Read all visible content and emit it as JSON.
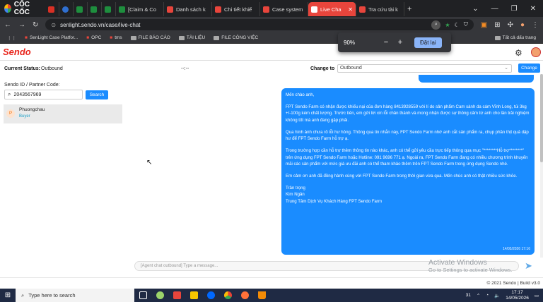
{
  "browser": {
    "brand": "CỐC CỐC",
    "tabs": [
      {
        "label": "",
        "color": "#d93025"
      },
      {
        "label": "",
        "color": "#2f6fd0"
      },
      {
        "label": "",
        "color": "#1e8e3e"
      },
      {
        "label": "",
        "color": "#1e8e3e"
      },
      {
        "label": "",
        "color": "#1e8e3e"
      },
      {
        "label": "[Claim & Co",
        "color": "#1e8e3e"
      },
      {
        "label": "Danh sách k",
        "color": "#e8453c"
      },
      {
        "label": "Chi tiết khiế",
        "color": "#e8453c"
      },
      {
        "label": "Case system",
        "color": "#e8453c"
      },
      {
        "label": "Live Cha",
        "color": "#e8453c",
        "active": true
      },
      {
        "label": "Tra cứu tài k",
        "color": "#e8453c"
      }
    ],
    "url": "senlight.sendo.vn/case/live-chat",
    "bookmarks": [
      "SenLight Case Platfor...",
      "OPC",
      "tms",
      "FILE BÁO CÁO",
      "TÀI LIỆU",
      "FILE CÔNG VIỆC"
    ],
    "all_bookmarks": "Tất cả dấu trang",
    "zoom": {
      "value": "90%",
      "minus": "−",
      "plus": "+",
      "reset": "Đặt lại"
    }
  },
  "app": {
    "logo": "Sendo",
    "status_label": "Current Status:",
    "status_value": "Outbound",
    "timer": "--:--",
    "change_to_label": "Change to",
    "change_to_value": "Outbound",
    "change_button": "Change"
  },
  "left": {
    "search_label": "Sendo ID / Partner Code:",
    "search_value": "2043567969",
    "search_button": "Search",
    "contacts": [
      {
        "initial": "P",
        "name": "Phuongchau",
        "role": "Buyer"
      }
    ]
  },
  "chat": {
    "paragraphs": [
      "Mến chào anh,",
      "FPT Sendo Farm có nhận được khiếu nại của đơn hàng 8413928559 với lí do sản phẩm Cam sành da cám Vĩnh Long, túi 3kg +/-100g kém chất lượng. Trước tiên, em gửi lời xin lỗi chân thành và mong nhận được sự thông cảm từ anh cho lần trải nghiệm không tốt mà anh đang gặp phải.",
      "Qua hình ảnh chưa rõ lỗi hư hỏng. Thông qua tin nhắn này, FPT Sendo Farm nhờ anh cắt sản phẩm ra, chụp phần thịt quả dập hư để FPT Sendo Farm hỗ trợ ạ.",
      "Trong trường hợp cần hỗ trợ thêm thông tin nào khác, anh có thể gửi yêu cầu trực tiếp thông qua mục \"********Hỗ trợ********\" trên ứng dụng FPT Sendo Farm  hoặc Hotline: 091 9696 771 ạ. Ngoài ra, FPT Sendo Farm đang có nhiều chương trình khuyến mãi các sản phẩm với mức giá ưu đãi anh có thể tham khảo thêm trên FPT Sendo Farm trong ứng dụng Sendo nhé.",
      "Em cảm ơn anh đã đồng hành cùng với FPT Sendo Farm trong thời gian vừa qua. Mến chúc anh có thật nhiều sức khỏe."
    ],
    "signature": [
      "Trân trọng",
      "Kim Ngân",
      "Trung Tâm Dịch Vụ Khách Hàng FPT Sendo Farm"
    ],
    "timestamp": "14/05/2026 17:16",
    "input_placeholder": "[Agent chat outbound] Type a message..."
  },
  "watermark": {
    "line1": "Activate Windows",
    "line2": "Go to Settings to activate Windows."
  },
  "footer": "© 2021 Sendo | Build v3.0",
  "taskbar": {
    "search_placeholder": "Type here to search",
    "time": "17:17",
    "date": "14/05/2026",
    "temp": "31"
  },
  "colors": {
    "brand_red": "#e8261d",
    "accent_blue": "#1a8cff",
    "chrome_dark": "#202124",
    "taskbar": "#1f2a44"
  }
}
